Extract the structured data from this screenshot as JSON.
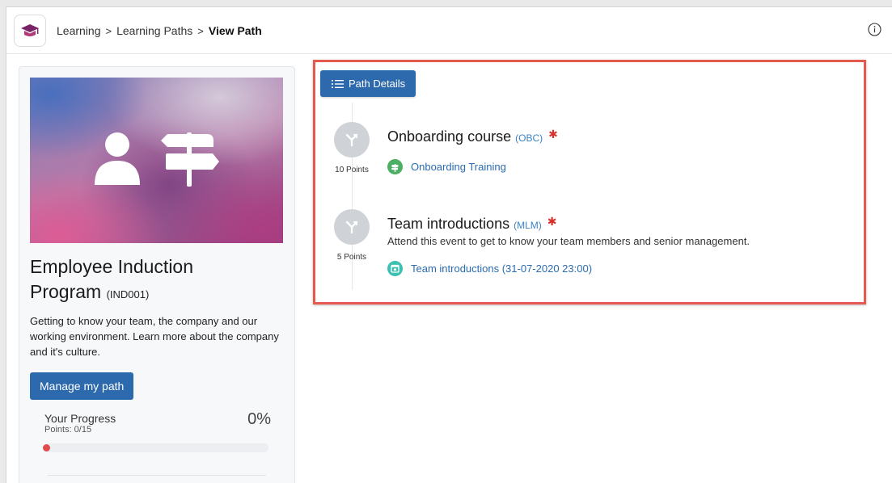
{
  "breadcrumb": {
    "items": [
      "Learning",
      "Learning Paths"
    ],
    "separator": ">",
    "current": "View Path"
  },
  "program": {
    "title_line1": "Employee Induction",
    "title_line2": "Program",
    "code": "(IND001)",
    "description": "Getting to know your team, the company and our working environment. Learn more about the company and it's culture.",
    "manage_button": "Manage my path",
    "progress_label": "Your Progress",
    "progress_points": "Points: 0/15",
    "progress_percent": "0%",
    "progress_value": 0
  },
  "path": {
    "details_button": "Path Details",
    "steps": [
      {
        "title": "Onboarding course",
        "code": "(OBC)",
        "required_marker": "✱",
        "points": "10 Points",
        "description": "",
        "link_label": "Onboarding Training",
        "link_icon": "signpost-icon"
      },
      {
        "title": "Team introductions",
        "code": "(MLM)",
        "required_marker": "✱",
        "points": "5 Points",
        "description": "Attend this event to get to know your team members and senior management.",
        "link_label": "Team introductions (31-07-2020 23:00)",
        "link_icon": "calendar-icon"
      }
    ]
  },
  "colors": {
    "primary": "#2c69ad",
    "highlight_border": "#e45a4f",
    "required": "#d9312b",
    "link": "#2b6cb0",
    "course_icon": "#4caf64",
    "event_icon": "#3cc0b0",
    "step_circle": "#cfd2d6"
  }
}
